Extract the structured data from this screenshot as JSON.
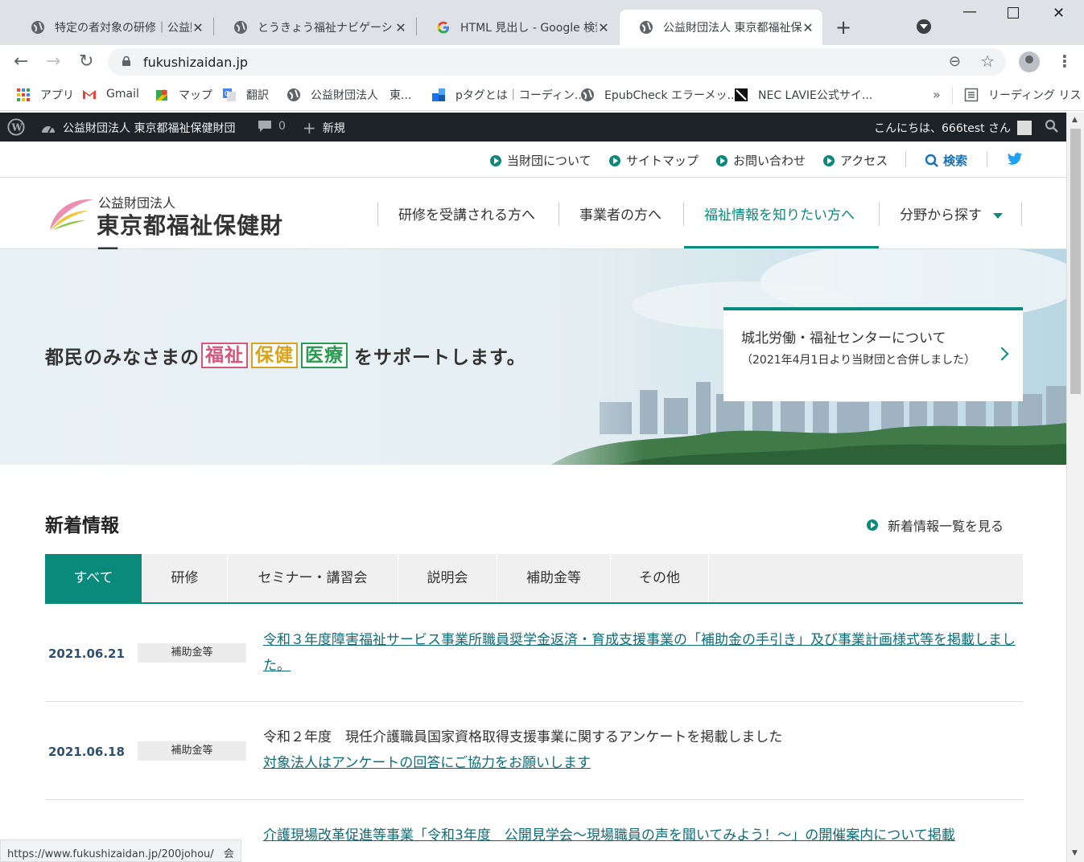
{
  "browser": {
    "tabs": [
      {
        "title": "特定の者対象の研修｜公益財団法人",
        "active": false
      },
      {
        "title": "とうきょう福祉ナビゲーション",
        "active": false
      },
      {
        "title": "HTML 見出し - Google 検索",
        "active": false
      },
      {
        "title": "公益財団法人 東京都福祉保健財団",
        "active": true
      }
    ],
    "new_tab_glyph": "+",
    "url": "fukushizaidan.jp",
    "bookmarks": [
      {
        "label": "アプリ",
        "icon": "apps-grid-icon"
      },
      {
        "label": "Gmail",
        "icon": "gmail-icon"
      },
      {
        "label": "マップ",
        "icon": "maps-icon"
      },
      {
        "label": "翻訳",
        "icon": "translate-icon"
      },
      {
        "label": "公益財団法人　東...",
        "icon": "globe-icon"
      },
      {
        "label": "pタグとは｜コーディン...",
        "icon": "blue-blocks-icon"
      },
      {
        "label": "EpubCheck エラーメッ...",
        "icon": "globe-icon"
      },
      {
        "label": "NEC LAVIE公式サイ...",
        "icon": "nec-icon"
      }
    ],
    "bookmarks_more": "»",
    "reading_list": "リーディング リスト",
    "status_url": "https://www.fukushizaidan.jp/200johou/",
    "status_tail": "会"
  },
  "adminbar": {
    "site_name": "公益財団法人 東京都福祉保健財団",
    "comments_count": "0",
    "new_label": "新規",
    "greeting": "こんにちは、666test さん"
  },
  "utility": {
    "links": [
      "当財団について",
      "サイトマップ",
      "お問い合わせ",
      "アクセス"
    ],
    "search_label": "検索"
  },
  "header": {
    "logo_small": "公益財団法人",
    "logo_big": "東京都福祉保健財団",
    "nav": [
      {
        "label": "研修を受講される方へ"
      },
      {
        "label": "事業者の方へ"
      },
      {
        "label": "福祉情報を知りたい方へ",
        "active": true
      },
      {
        "label": "分野から探す"
      }
    ]
  },
  "hero": {
    "catch_pre": "都民のみなさまの",
    "keywords": [
      "福祉",
      "保健",
      "医療"
    ],
    "catch_post": "をサポートします。",
    "card_title": "城北労働・福祉センターについて",
    "card_sub": "（2021年4月1日より当財団と合併しました）"
  },
  "news": {
    "heading": "新着情報",
    "view_all": "新着情報一覧を見る",
    "tabs": [
      "すべて",
      "研修",
      "セミナー・講習会",
      "説明会",
      "補助金等",
      "その他"
    ],
    "items": [
      {
        "date": "2021.06.21",
        "category": "補助金等",
        "text": "",
        "link": "令和３年度障害福祉サービス事業所職員奨学金返済・育成支援事業の「補助金の手引き」及び事業計画様式等を掲載しました。"
      },
      {
        "date": "2021.06.18",
        "category": "補助金等",
        "text": "令和２年度　現任介護職員国家資格取得支援事業に関するアンケートを掲載しました",
        "link": "対象法人はアンケートの回答にご協力をお願いします"
      },
      {
        "date": "",
        "category": "",
        "text": "",
        "link": "介護現場改革促進等事業「令和3年度　公開見学会～現場職員の声を聞いてみよう！～」の開催案内について掲載"
      }
    ]
  },
  "colors": {
    "accent": "#0a8a7a",
    "kw_welfare": "#d4587b",
    "kw_health": "#d9a31e",
    "kw_medical": "#2c9a52",
    "adminbar": "#1d2327"
  }
}
